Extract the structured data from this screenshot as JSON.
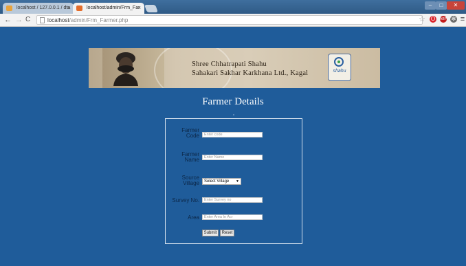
{
  "browser": {
    "tabs": [
      {
        "label": "localhost / 127.0.0.1 / dta"
      },
      {
        "label": "localhost/admin/Frm_Far"
      }
    ],
    "url_host": "localhost",
    "url_path": "/admin/Frm_Farmer.php"
  },
  "banner": {
    "line1": "Shree  Chhatrapati  Shahu",
    "line2": "Sahakari  Sakhar  Karkhana  Ltd.,  Kagal",
    "logo_text": "shahu"
  },
  "page": {
    "title": "Farmer Details"
  },
  "form": {
    "farmer_code_label_1": "Farmer",
    "farmer_code_label_2": "Code",
    "farmer_code_placeholder": "Enter code",
    "farmer_name_label_1": "Farmer",
    "farmer_name_label_2": "Name",
    "farmer_name_placeholder": "Enter Name",
    "village_label_1": "Source",
    "village_label_2": "Village",
    "village_selected": "Select Village",
    "survey_label": "Survey No.",
    "survey_placeholder": "Enter Survey no",
    "area_label": "Area",
    "area_placeholder": "Enter Area In Acr",
    "submit_label": "Submit",
    "reset_label": "Reset"
  },
  "colors": {
    "page_bg": "#1f5c9a",
    "label_text": "#0c2747",
    "title_text": "#ffffff"
  }
}
